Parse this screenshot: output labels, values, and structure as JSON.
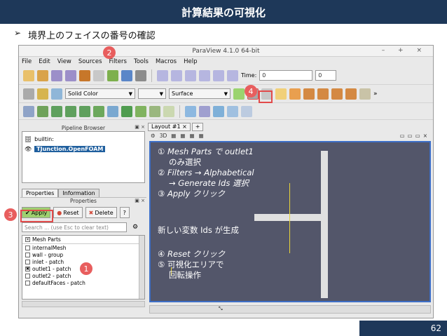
{
  "slide": {
    "title": "計算結果の可視化",
    "bullet": "境界上のフェイスの番号の確認",
    "page_number": "62"
  },
  "window": {
    "title": "ParaView 4.1.0 64-bit",
    "controls": "– + ×"
  },
  "menu": [
    "File",
    "Edit",
    "View",
    "Sources",
    "Filters",
    "Tools",
    "Macros",
    "Help"
  ],
  "toolbar": {
    "time_label": "Time:",
    "time_value": "0",
    "time_index": "0",
    "color_by": "Solid Color",
    "representation": "Surface"
  },
  "pipeline": {
    "title": "Pipeline Browser",
    "root": "builtin:",
    "source": "TJunction.OpenFOAM"
  },
  "properties": {
    "tab_properties": "Properties",
    "tab_information": "Information",
    "panel_title": "Properties",
    "apply": "Apply",
    "reset": "Reset",
    "delete": "Delete",
    "help": "?",
    "search_placeholder": "Search ... (use Esc to clear text)",
    "mesh_header": "Mesh Parts",
    "mesh_items": [
      {
        "label": "internalMesh",
        "checked": false
      },
      {
        "label": "wall - group",
        "checked": false
      },
      {
        "label": "inlet - patch",
        "checked": false
      },
      {
        "label": "outlet1 - patch",
        "checked": true
      },
      {
        "label": "outlet2 - patch",
        "checked": false
      },
      {
        "label": "defaultFaces - patch",
        "checked": false
      }
    ]
  },
  "layout": {
    "tab": "Layout #1 ×",
    "add_tab": "+",
    "view_3d": "3D"
  },
  "instructions": {
    "l1": "① Mesh Parts で outlet1",
    "l2": "のみ選択",
    "l3": "② Filters → Alphabetical",
    "l4": "→ Generate Ids 選択",
    "l5": "③ Apply クリック",
    "l6": "新しい変数 Ids が生成",
    "l7": "④ Reset クリック",
    "l8": "⑤ 可視化エリアで",
    "l9": "回転操作"
  },
  "badges": {
    "b1": "1",
    "b2": "2",
    "b3": "3",
    "b4": "4"
  },
  "colors": {
    "header_bg": "#1e3859",
    "badge": "#e85e5e",
    "viewport_bg": "#53566a",
    "selection": "#1f5f9e"
  }
}
